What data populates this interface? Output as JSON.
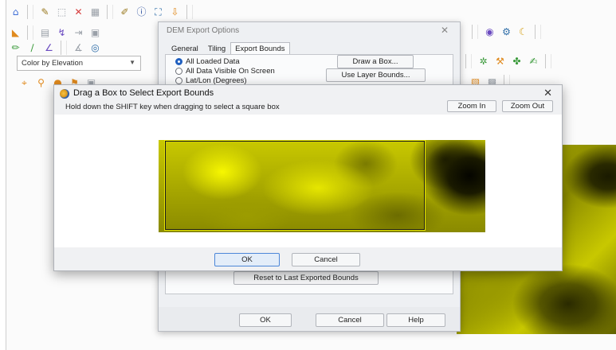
{
  "main_app": {
    "color_mode_combo": "Color by Elevation"
  },
  "dem_dialog": {
    "title": "DEM Export Options",
    "close_glyph": "✕",
    "tabs": [
      {
        "label": "General"
      },
      {
        "label": "Tiling"
      },
      {
        "label": "Export Bounds"
      }
    ],
    "options": [
      {
        "label": "All Loaded Data",
        "selected": true
      },
      {
        "label": "All Data Visible On Screen",
        "selected": false
      },
      {
        "label": "Lat/Lon (Degrees)",
        "selected": false
      }
    ],
    "draw_box_label": "Draw a Box...",
    "use_layer_bounds_label": "Use Layer Bounds...",
    "reset_label": "Reset to Last Exported Bounds",
    "ok_label": "OK",
    "cancel_label": "Cancel",
    "help_label": "Help"
  },
  "drag_dialog": {
    "title": "Drag a Box to Select Export Bounds",
    "close_glyph": "✕",
    "hint": "Hold down the SHIFT key when dragging to select a square box",
    "zoom_in_label": "Zoom In",
    "zoom_out_label": "Zoom Out",
    "ok_label": "OK",
    "cancel_label": "Cancel"
  },
  "colors": {
    "accent": "#1f5fbf",
    "dem_low": "#8a8a00",
    "dem_high": "#f7f700",
    "dem_dark": "#050500"
  }
}
